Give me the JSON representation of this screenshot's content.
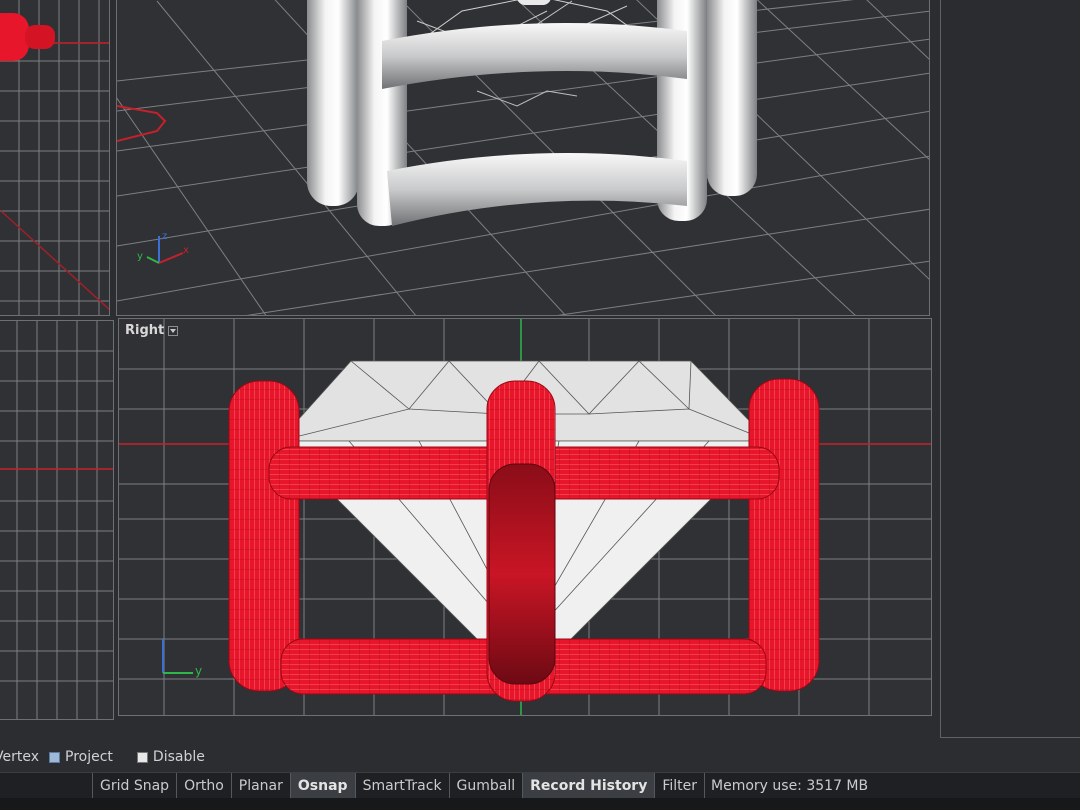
{
  "viewports": {
    "right": {
      "label": "Right"
    }
  },
  "osnap_options": {
    "vertex_label": "Vertex",
    "project_label": "Project",
    "project_checked": true,
    "disable_label": "Disable",
    "disable_checked": false
  },
  "axis_labels": {
    "persp_x": "x",
    "persp_y": "y",
    "persp_z": "z",
    "right_y": "y"
  },
  "status_bar": {
    "panes": [
      {
        "label": "Grid Snap",
        "active": false
      },
      {
        "label": "Ortho",
        "active": false
      },
      {
        "label": "Planar",
        "active": false
      },
      {
        "label": "Osnap",
        "active": true
      },
      {
        "label": "SmartTrack",
        "active": false
      },
      {
        "label": "Gumball",
        "active": false
      },
      {
        "label": "Record History",
        "active": true
      },
      {
        "label": "Filter",
        "active": false
      }
    ],
    "memory": "Memory use: 3517 MB"
  },
  "colors": {
    "selection_red": "#e8162a",
    "grid_line": "#7d8083",
    "axis_red": "#c8202a",
    "axis_green": "#2fb84a",
    "axis_blue": "#3a6fd8",
    "metal": "#e6e6e6"
  }
}
